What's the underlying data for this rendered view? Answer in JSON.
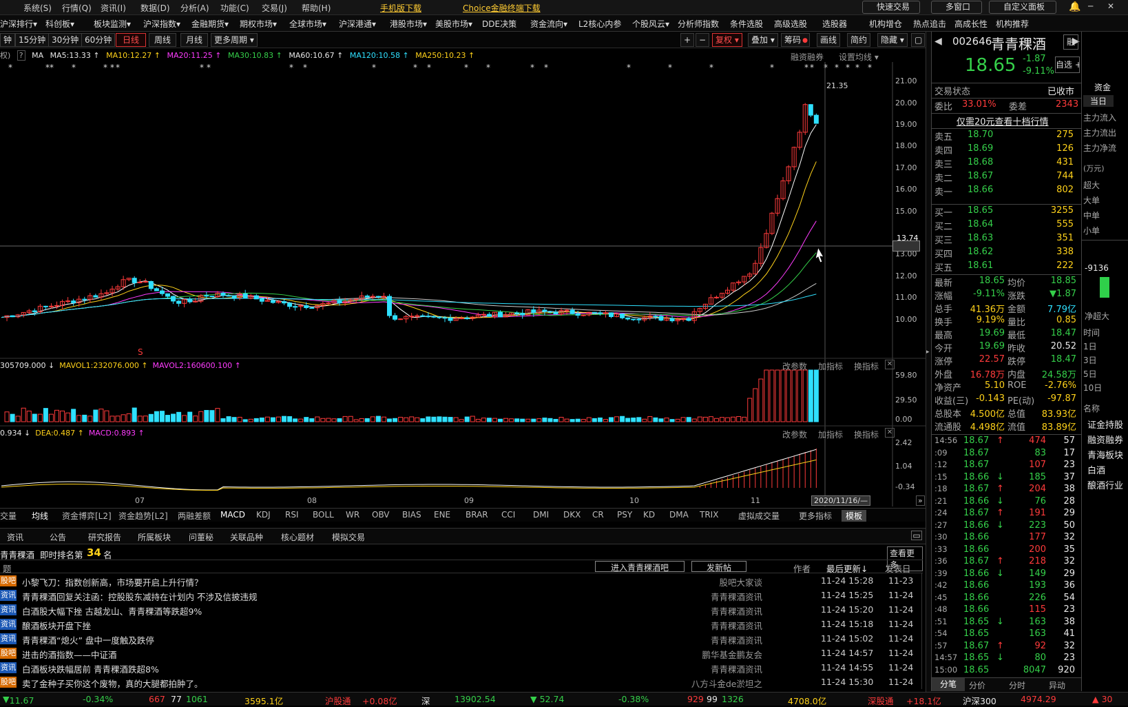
{
  "menu": [
    "系统(S)",
    "行情(Q)",
    "资讯(I)",
    "数据(D)",
    "分析(A)",
    "功能(C)",
    "交易(J)",
    "帮助(H)"
  ],
  "menu_links": {
    "mobile": "手机版下载",
    "choice": "Choice金融终端下载"
  },
  "top_right": {
    "quick_trade": "快速交易",
    "multi_window": "多窗口",
    "custom_panel": "自定义面板"
  },
  "nav": [
    "沪深排行▾",
    "科创板▾",
    "板块监测▾",
    "沪深指数▾",
    "金融期货▾",
    "期权市场▾",
    "全球市场▾",
    "沪深港通▾",
    "港股市场▾",
    "美股市场▾",
    "DDE决策",
    "资金流向▾",
    "L2核心内参",
    "个股风云▾",
    "分析师指数",
    "条件选股",
    "高级选股",
    "选股器",
    "机构增仓",
    "热点追击",
    "高成长性",
    "机构推荐"
  ],
  "periods": {
    "p1": "钟",
    "p15": "15分钟",
    "p30": "30分钟",
    "p60": "60分钟",
    "day": "日线",
    "week": "周线",
    "month": "月线",
    "more": "更多周期 ▾"
  },
  "toolbar": {
    "plus": "+",
    "minus": "−",
    "fq": "复权 ▾",
    "overlay": "叠加 ▾",
    "chips": "筹码",
    "draw": "画线",
    "simple": "简约",
    "hide": "隐藏 ▾"
  },
  "ma": {
    "prefix": "权)",
    "ma": "MA",
    "ma5": "MA5:13.33 ↑",
    "ma10": "MA10:12.27 ↑",
    "ma20": "MA20:11.25 ↑",
    "ma30": "MA30:10.83 ↑",
    "ma60": "MA60:10.67 ↑",
    "ma120": "MA120:10.58 ↑",
    "ma250": "MA250:10.23 ↑",
    "rzrq": "融资融券",
    "set_ma": "设置均线 ▾"
  },
  "price_axis": [
    "21.00",
    "20.00",
    "19.00",
    "18.00",
    "17.00",
    "16.00",
    "15.00",
    "13.74",
    "13.00",
    "12.00",
    "11.00",
    "10.00"
  ],
  "high_label": "21.35",
  "s_mark": "S",
  "vol": {
    "title": "305709.000 ↓",
    "mavol1": "MAVOL1:232076.000 ↑",
    "mavol2": "MAVOL2:160600.100 ↑",
    "axis": [
      "59.80",
      "29.50",
      "0.00"
    ]
  },
  "macd": {
    "dif": "0.934 ↓",
    "dea": "DEA:0.487 ↑",
    "macd": "MACD:0.893 ↑",
    "axis": [
      "2.42",
      "1.04",
      "-0.34"
    ]
  },
  "panel_btns": {
    "change": "改参数",
    "add": "加指标",
    "swap": "换指标"
  },
  "months": [
    "07",
    "08",
    "09",
    "10",
    "11"
  ],
  "cursor_date": "2020/11/16/—",
  "indicators": [
    "交量",
    "均线",
    "资金博弈[L2]",
    "资金趋势[L2]",
    "两融差额",
    "MACD",
    "KDJ",
    "RSI",
    "BOLL",
    "WR",
    "OBV",
    "BIAS",
    "ENE",
    "BRAR",
    "CCI",
    "DMI",
    "DKX",
    "CR",
    "PSY",
    "KD",
    "DMA",
    "TRIX",
    "虚拟成交量",
    "更多指标",
    "模板"
  ],
  "info_tabs": [
    "资讯",
    "公告",
    "研究报告",
    "所属板块",
    "问董秘",
    "关联品种",
    "核心题材",
    "模拟交易"
  ],
  "news_header": {
    "stock": "青青稞酒",
    "rank_label": "即时排名第",
    "rank": "34",
    "rank_unit": "名",
    "view_more": "查看更多",
    "col_title": "题",
    "enter_bar": "进入青青稞酒吧",
    "post": "发新帖",
    "author": "作者",
    "last_update": "最后更新↓",
    "pub": "发表日"
  },
  "news": [
    {
      "tag": "股吧",
      "color": "orange",
      "title": "小黎飞刀：指数创新高，市场要开启上升行情？",
      "author": "股吧大家谈",
      "date": "11-24 15:28",
      "pub": "11-23"
    },
    {
      "tag": "资讯",
      "color": "blue",
      "title": "青青稞酒回复关注函：控股股东减持在计划内 不涉及信披违规",
      "author": "青青稞酒资讯",
      "date": "11-24 15:25",
      "pub": "11-24"
    },
    {
      "tag": "资讯",
      "color": "blue",
      "title": "白酒股大幅下挫 古越龙山、青青稞酒等跌超9%",
      "author": "青青稞酒资讯",
      "date": "11-24 15:20",
      "pub": "11-24"
    },
    {
      "tag": "资讯",
      "color": "blue",
      "title": "酿酒板块开盘下挫",
      "author": "青青稞酒资讯",
      "date": "11-24 15:18",
      "pub": "11-24"
    },
    {
      "tag": "资讯",
      "color": "blue",
      "title": "青青稞酒“熄火” 盘中一度触及跌停",
      "author": "青青稞酒资讯",
      "date": "11-24 15:02",
      "pub": "11-24"
    },
    {
      "tag": "股吧",
      "color": "orange",
      "title": "进击的酒指数——中证酒",
      "author": "鹏华基金鹏友会",
      "date": "11-24 14:57",
      "pub": "11-24"
    },
    {
      "tag": "资讯",
      "color": "blue",
      "title": "白酒板块跌幅居前 青青稞酒跌超8%",
      "author": "青青稞酒资讯",
      "date": "11-24 14:55",
      "pub": "11-24"
    },
    {
      "tag": "股吧",
      "color": "orange",
      "title": "卖了金种子买你这个废物，真的大腿都拍肿了。",
      "author": "八方斗金de淤坦之",
      "date": "11-24 15:30",
      "pub": "11-24"
    }
  ],
  "stock": {
    "code": "002646",
    "name": "青青稞酒",
    "price": "18.65",
    "change": "-1.87",
    "pct": "-9.11%",
    "rong": "融",
    "zixuan": "自选 +"
  },
  "trade_status": {
    "label": "交易状态",
    "value": "已收市"
  },
  "weibi": {
    "label1": "委比",
    "v1": "33.01%",
    "label2": "委差",
    "v2": "2343"
  },
  "ten_level": "仅需20元查看十档行情",
  "asks": [
    {
      "n": "卖五",
      "p": "18.70",
      "v": "275"
    },
    {
      "n": "卖四",
      "p": "18.69",
      "v": "126"
    },
    {
      "n": "卖三",
      "p": "18.68",
      "v": "431"
    },
    {
      "n": "卖二",
      "p": "18.67",
      "v": "744"
    },
    {
      "n": "卖一",
      "p": "18.66",
      "v": "802"
    }
  ],
  "bids": [
    {
      "n": "买一",
      "p": "18.65",
      "v": "3255"
    },
    {
      "n": "买二",
      "p": "18.64",
      "v": "555"
    },
    {
      "n": "买三",
      "p": "18.63",
      "v": "351"
    },
    {
      "n": "买四",
      "p": "18.62",
      "v": "338"
    },
    {
      "n": "买五",
      "p": "18.61",
      "v": "222"
    }
  ],
  "stats": [
    {
      "l1": "最新",
      "v1": "18.65",
      "c1": "green",
      "l2": "均价",
      "v2": "18.85",
      "c2": "green"
    },
    {
      "l1": "涨幅",
      "v1": "-9.11%",
      "c1": "green",
      "l2": "涨跌",
      "v2": "▼1.87",
      "c2": "green"
    },
    {
      "l1": "总手",
      "v1": "41.36万",
      "c1": "yellow",
      "l2": "金额",
      "v2": "7.79亿",
      "c2": "cyan"
    },
    {
      "l1": "换手",
      "v1": "9.19%",
      "c1": "yellow",
      "l2": "量比",
      "v2": "0.85",
      "c2": "yellow"
    },
    {
      "l1": "最高",
      "v1": "19.69",
      "c1": "green",
      "l2": "最低",
      "v2": "18.47",
      "c2": "green"
    },
    {
      "l1": "今开",
      "v1": "19.69",
      "c1": "green",
      "l2": "昨收",
      "v2": "20.52",
      "c2": "white"
    },
    {
      "l1": "涨停",
      "v1": "22.57",
      "c1": "red",
      "l2": "跌停",
      "v2": "18.47",
      "c2": "green"
    },
    {
      "l1": "外盘",
      "v1": "16.78万",
      "c1": "red",
      "l2": "内盘",
      "v2": "24.58万",
      "c2": "green"
    },
    {
      "l1": "净资产",
      "v1": "5.10",
      "c1": "yellow",
      "l2": "ROE",
      "v2": "-2.76%",
      "c2": "yellow"
    },
    {
      "l1": "收益(三)",
      "v1": "-0.143",
      "c1": "yellow",
      "l2": "PE(动)",
      "v2": "-97.87",
      "c2": "yellow"
    },
    {
      "l1": "总股本",
      "v1": "4.500亿",
      "c1": "yellow",
      "l2": "总值",
      "v2": "83.93亿",
      "c2": "yellow"
    },
    {
      "l1": "流通股",
      "v1": "4.498亿",
      "c1": "yellow",
      "l2": "流值",
      "v2": "83.89亿",
      "c2": "yellow"
    }
  ],
  "ticks": [
    {
      "t": "14:56",
      "p": "18.67",
      "a": "↑",
      "ac": "red",
      "v": "474",
      "vc": "red",
      "n": "57"
    },
    {
      "t": ":09",
      "p": "18.67",
      "a": "",
      "ac": "red",
      "v": "83",
      "vc": "green",
      "n": "17"
    },
    {
      "t": ":12",
      "p": "18.67",
      "a": "",
      "ac": "red",
      "v": "107",
      "vc": "red",
      "n": "23"
    },
    {
      "t": ":15",
      "p": "18.66",
      "a": "↓",
      "ac": "green",
      "v": "185",
      "vc": "green",
      "n": "37"
    },
    {
      "t": ":18",
      "p": "18.67",
      "a": "↑",
      "ac": "red",
      "v": "204",
      "vc": "red",
      "n": "38"
    },
    {
      "t": ":21",
      "p": "18.66",
      "a": "↓",
      "ac": "green",
      "v": "76",
      "vc": "green",
      "n": "28"
    },
    {
      "t": ":24",
      "p": "18.67",
      "a": "↑",
      "ac": "red",
      "v": "191",
      "vc": "red",
      "n": "29"
    },
    {
      "t": ":27",
      "p": "18.66",
      "a": "↓",
      "ac": "green",
      "v": "223",
      "vc": "green",
      "n": "50"
    },
    {
      "t": ":30",
      "p": "18.66",
      "a": "",
      "ac": "green",
      "v": "177",
      "vc": "red",
      "n": "32"
    },
    {
      "t": ":33",
      "p": "18.66",
      "a": "",
      "ac": "green",
      "v": "200",
      "vc": "red",
      "n": "35"
    },
    {
      "t": ":36",
      "p": "18.67",
      "a": "↑",
      "ac": "red",
      "v": "218",
      "vc": "red",
      "n": "32"
    },
    {
      "t": ":39",
      "p": "18.66",
      "a": "↓",
      "ac": "green",
      "v": "149",
      "vc": "green",
      "n": "29"
    },
    {
      "t": ":42",
      "p": "18.66",
      "a": "",
      "ac": "green",
      "v": "193",
      "vc": "green",
      "n": "36"
    },
    {
      "t": ":45",
      "p": "18.66",
      "a": "",
      "ac": "green",
      "v": "226",
      "vc": "green",
      "n": "54"
    },
    {
      "t": ":48",
      "p": "18.66",
      "a": "",
      "ac": "green",
      "v": "115",
      "vc": "red",
      "n": "23"
    },
    {
      "t": ":51",
      "p": "18.65",
      "a": "↓",
      "ac": "green",
      "v": "163",
      "vc": "green",
      "n": "38"
    },
    {
      "t": ":54",
      "p": "18.65",
      "a": "",
      "ac": "green",
      "v": "163",
      "vc": "green",
      "n": "41"
    },
    {
      "t": ":57",
      "p": "18.67",
      "a": "↑",
      "ac": "red",
      "v": "92",
      "vc": "red",
      "n": "32"
    },
    {
      "t": "14:57",
      "p": "18.65",
      "a": "↓",
      "ac": "green",
      "v": "80",
      "vc": "green",
      "n": "23"
    },
    {
      "t": "15:00",
      "p": "18.65",
      "a": "",
      "ac": "green",
      "v": "8047",
      "vc": "green",
      "n": "920"
    }
  ],
  "bottom_tabs": [
    "分笔",
    "分价",
    "分时",
    "异动"
  ],
  "edge": {
    "zijin": "资金",
    "dangri": "当日",
    "in": "主力流入",
    "out": "主力流出",
    "net": "主力净流",
    "unit": "(万元)",
    "super": "超大",
    "big": "大单",
    "mid": "中单",
    "small": "小单",
    "val": "-9136",
    "net_super": "净超大",
    "time": "时间",
    "d1": "1日",
    "d3": "3日",
    "d5": "5日",
    "d10": "10日",
    "name": "名称",
    "items": [
      "证金持股",
      "融资融券",
      "青海板块",
      "白酒",
      "酿酒行业"
    ]
  },
  "status": {
    "v1": "11.67",
    "v2": "-0.34%",
    "v3": "667",
    "v4": "77",
    "v5": "1061",
    "v6": "3595.1亿",
    "hgt": "沪股通",
    "hgt_v": "+0.08亿",
    "shen": "深",
    "v7": "13902.54",
    "v8": "▼ 52.74",
    "v9": "-0.38%",
    "v10": "929",
    "v11": "99",
    "v12": "1326",
    "v13": "4708.0亿",
    "sgt": "深股通",
    "sgt_v": "+18.1亿",
    "hs300": "沪深300",
    "v14": "4974.29",
    "v15": "▲ 30"
  }
}
